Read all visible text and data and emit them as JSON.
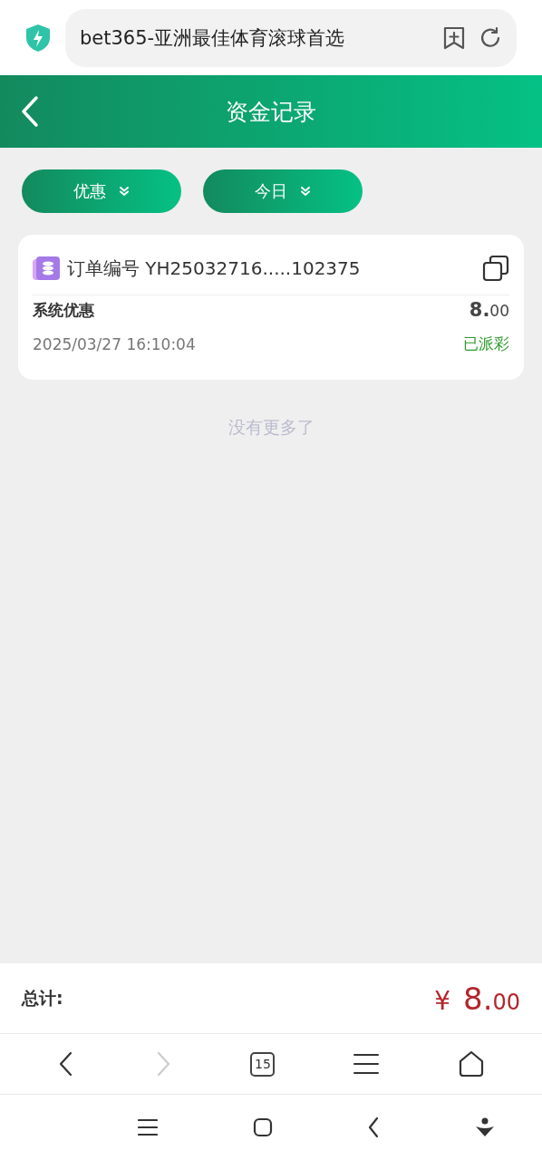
{
  "browser": {
    "address": "bet365-亚洲最佳体育滚球首选"
  },
  "header": {
    "title": "资金记录"
  },
  "filters": [
    {
      "label": "优惠"
    },
    {
      "label": "今日"
    }
  ],
  "records": [
    {
      "order": "订单编号 YH25032716.....102375",
      "type": "系统优惠",
      "amount": "**8.**00",
      "time": "2025/03/27 16:10:04",
      "status": "已派彩"
    }
  ],
  "end_text": "没有更多了",
  "total": {
    "label": "总计:",
    "currency": "¥",
    "amount": "**8.**00"
  },
  "toolbar": {
    "back_disabled": false,
    "forward_disabled": true,
    "tab_count": "15"
  }
}
